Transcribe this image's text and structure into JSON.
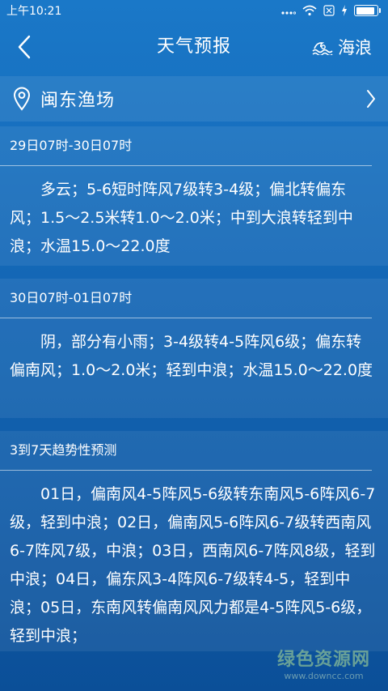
{
  "status_bar": {
    "time": "上午10:21",
    "icons": [
      "signal-icon",
      "wifi-icon",
      "sim-icon",
      "charging-icon",
      "battery-icon"
    ],
    "battery_level": 0.9
  },
  "header": {
    "title": "天气预报",
    "back_icon": "chevron-left-icon",
    "waves_icon": "waves-icon",
    "waves_label": "海浪"
  },
  "location": {
    "icon": "location-pin-icon",
    "name": "闽东渔场",
    "chevron_icon": "chevron-right-icon"
  },
  "forecasts": [
    {
      "period": "29日07时-30日07时",
      "text": "多云；5-6短时阵风7级转3-4级；偏北转偏东风；1.5～2.5米转1.0～2.0米；中到大浪转轻到中浪；水温15.0～22.0度"
    },
    {
      "period": "30日07时-01日07时",
      "text": "阴，部分有小雨；3-4级转4-5阵风6级；偏东转偏南风；1.0～2.0米；轻到中浪；水温15.0～22.0度"
    },
    {
      "period": "3到7天趋势性预测",
      "text": "01日，偏南风4-5阵风5-6级转东南风5-6阵风6-7级，轻到中浪；02日，偏南风5-6阵风6-7级转西南风6-7阵风7级，中浪；03日，西南风6-7阵风8级，轻到中浪；04日，偏东风3-4阵风6-7级转4-5，轻到中浪；05日，东南风转偏南风风力都是4-5阵风5-6级，轻到中浪；"
    }
  ],
  "watermark": {
    "main": "绿色资源网",
    "url": "www.downcc.com"
  },
  "colors": {
    "background_top": "#1a78c8",
    "background_bottom": "#0b4f98",
    "text": "#ffffff"
  }
}
